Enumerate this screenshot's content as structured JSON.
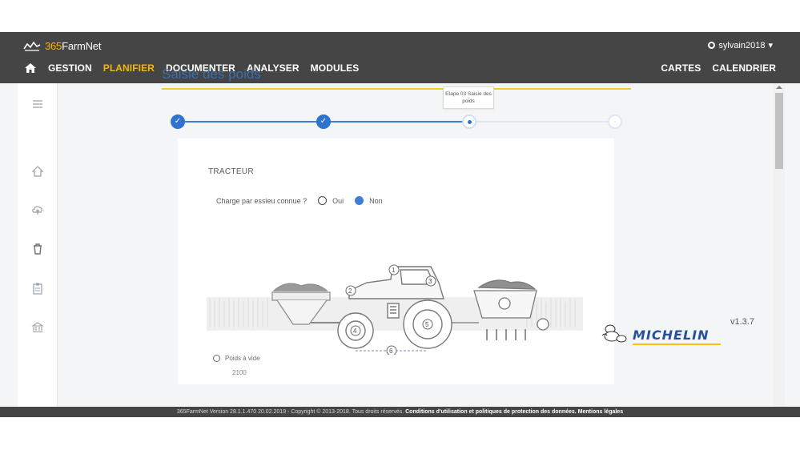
{
  "app": {
    "brand_number": "365",
    "brand_name": "FarmNet",
    "user": "sylvain2018",
    "nav_left": [
      "GESTION",
      "PLANIFIER",
      "DOCUMENTER",
      "ANALYSER",
      "MODULES"
    ],
    "nav_active": "PLANIFIER",
    "nav_right": [
      "CARTES",
      "CALENDRIER"
    ]
  },
  "colors": {
    "topbar": "#454545",
    "accent_yellow": "#f5b800",
    "title_blue": "#3a6fb0",
    "step_blue": "#2e74cf",
    "title_underline": "#f2d01d"
  },
  "sidebar": {
    "icons": [
      "menu-icon",
      "home-icon",
      "cloud-upload-icon",
      "trash-icon",
      "clipboard-icon",
      "bank-icon"
    ]
  },
  "page": {
    "title": "Saisie des poids",
    "tooltip": "Etape 03 Saisie des poids",
    "section": "TRACTEUR",
    "question": "Charge par essieu connue ?",
    "option_yes": "Oui",
    "option_no": "Non",
    "selected_option": "Non",
    "weight_label": "Poids à vide",
    "weight_value": "2100",
    "diagram_labels": [
      "1",
      "2",
      "3",
      "4",
      "5",
      "6"
    ]
  },
  "branding": {
    "partner": "MICHELIN",
    "version": "v1.3.7"
  },
  "footer": {
    "text": "365FarmNet Version 28.1.1.470 20.02.2019 - Copyright © 2013-2018. Tous droits réservés.",
    "link": "Conditions d'utilisation et politiques de protection des données. Mentions légales"
  }
}
